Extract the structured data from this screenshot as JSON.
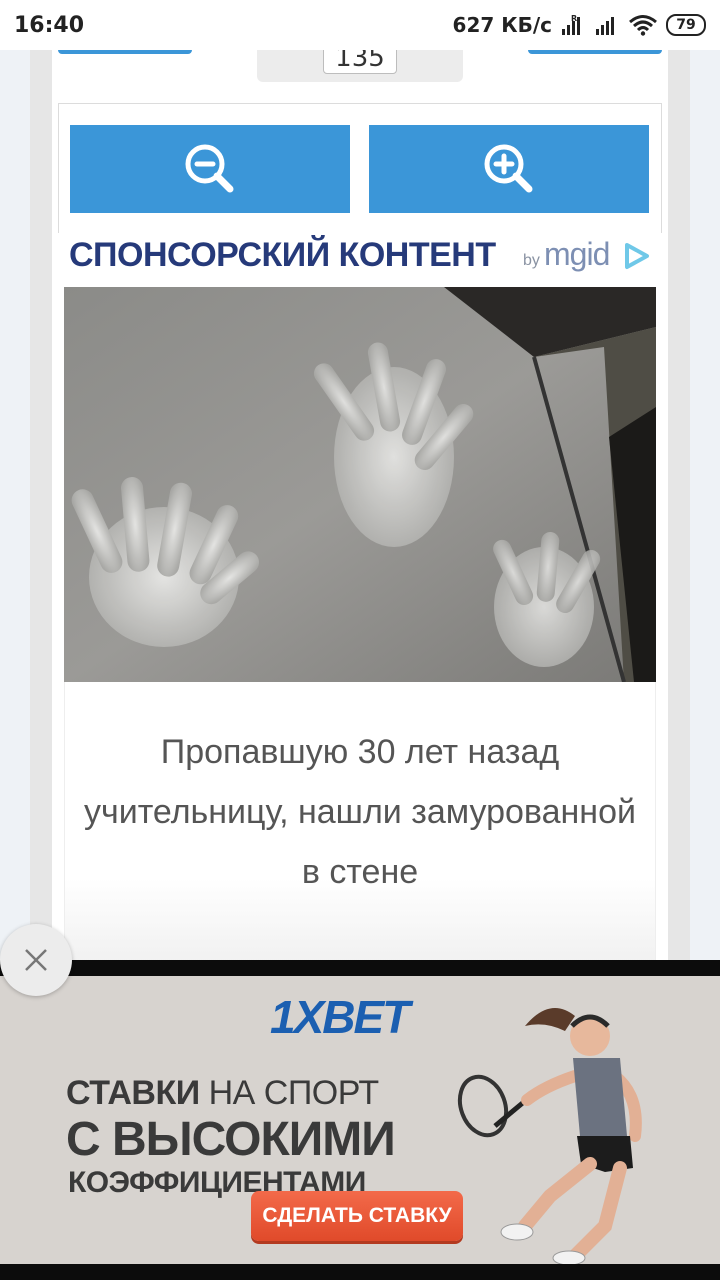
{
  "status_bar": {
    "time": "16:40",
    "net_speed": "627 КБ/с",
    "battery": "79"
  },
  "pagination": {
    "page_number": "135"
  },
  "zoom": {
    "zoom_out_icon": "zoom-out-icon",
    "zoom_in_icon": "zoom-in-icon",
    "button_color": "#3b96d8"
  },
  "sponsored": {
    "title": "СПОНСОРСКИЙ КОНТЕНТ",
    "provider_by": "by",
    "provider_name": "mgid",
    "title_color": "#263a7a"
  },
  "article": {
    "title": "Пропавшую 30 лет назад учительницу, нашли замурованной в стене"
  },
  "ad": {
    "brand": "1XBET",
    "line1_bold": "СТАВКИ",
    "line1_rest": " НА СПОРТ",
    "line2": "С ВЫСОКИМИ",
    "line3": "КОЭФФИЦИЕНТАМИ",
    "cta": "СДЕЛАТЬ СТАВКУ",
    "brand_color": "#1b5fb1",
    "cta_color": "#e85535"
  }
}
